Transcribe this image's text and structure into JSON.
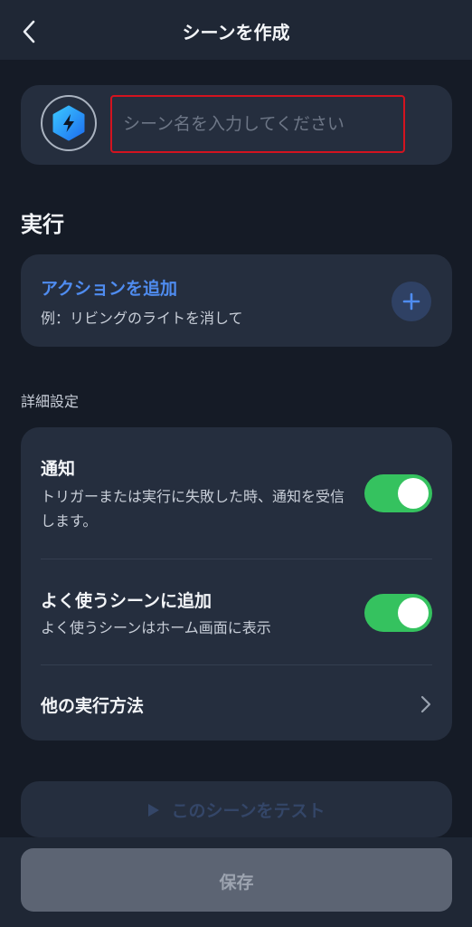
{
  "header": {
    "title": "シーンを作成"
  },
  "scene_name": {
    "placeholder": "シーン名を入力してください",
    "value": ""
  },
  "execute": {
    "section_title": "実行",
    "add_action_title": "アクションを追加",
    "add_action_example": "例：リビングのライトを消して"
  },
  "advanced": {
    "label": "詳細設定",
    "notification": {
      "title": "通知",
      "description": "トリガーまたは実行に失敗した時、通知を受信します。",
      "enabled": true
    },
    "favorite": {
      "title": "よく使うシーンに追加",
      "description": "よく使うシーンはホーム画面に表示",
      "enabled": true
    },
    "other_methods": {
      "title": "他の実行方法"
    }
  },
  "buttons": {
    "test": "このシーンをテスト",
    "save": "保存"
  },
  "colors": {
    "accent": "#4f8cf0",
    "toggle_on": "#35c25f",
    "input_highlight": "#d3131f",
    "icon_gradient_start": "#3bc6ff",
    "icon_gradient_end": "#1d6ff0"
  }
}
